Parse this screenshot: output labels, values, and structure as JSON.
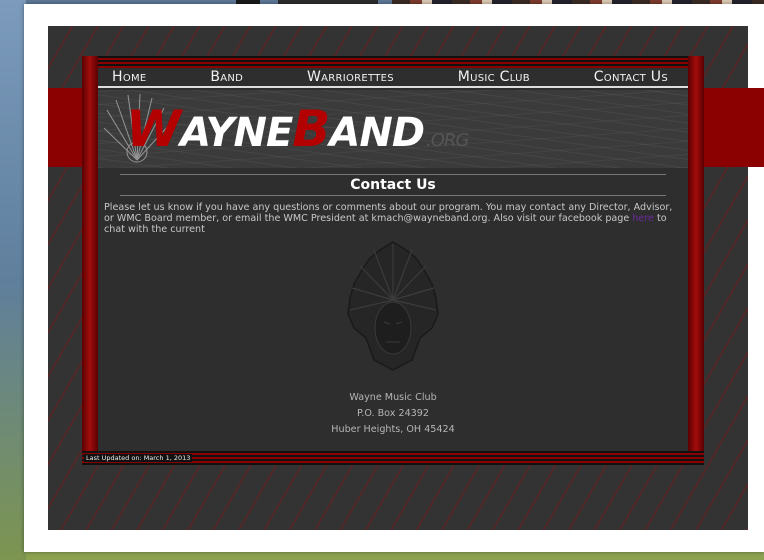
{
  "nav": {
    "home": "Home",
    "band": "Band",
    "warriorettes": "Warriorettes",
    "music_club": "Music Club",
    "contact_us": "Contact Us"
  },
  "logo": {
    "w": "W",
    "ayne": "AYNE",
    "b": "B",
    "and": "AND",
    "org": ".ORG"
  },
  "page": {
    "title": "Contact Us",
    "body_before_link": "Please let us know if you have any questions or comments about our program. You may contact any Director, Advisor, or WMC Board member, or email the WMC President at kmach@wayneband.org. Also visit our facebook page ",
    "link_text": "here",
    "body_after_link": " to chat with the current"
  },
  "address": {
    "line1": "Wayne Music Club",
    "line2": "P.O. Box 24392",
    "line3": "Huber Heights, OH 45424"
  },
  "footer": {
    "updated": "Last Updated on: March 1, 2013"
  },
  "colors": {
    "brand_red": "#8b0000",
    "logo_red": "#b30000",
    "background": "#333333",
    "link": "#6b2aa0"
  }
}
